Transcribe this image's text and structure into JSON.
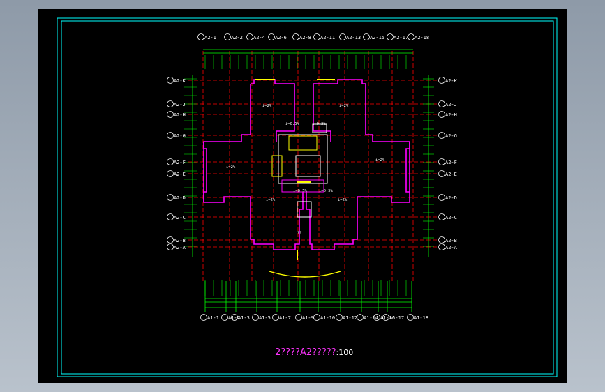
{
  "drawing": {
    "title_main": "2????A2?????",
    "title_scale": ":100",
    "colors": {
      "background": "#000000",
      "frame": "#00ffff",
      "axis": "#ff0000",
      "dimension": "#00ff00",
      "wall": "#ff00ff",
      "text": "#ffffff",
      "accent": "#ffff00"
    },
    "top_axes": [
      "A2-1",
      "A2-2",
      "A2-4",
      "A2-6",
      "A2-8",
      "A2-11",
      "A2-13",
      "A2-15",
      "A2-17",
      "A2-18"
    ],
    "bottom_axes": [
      "A1-1",
      "A1-2",
      "A1-3",
      "A1-5",
      "A1-7",
      "A1-9",
      "A1-10",
      "A1-12",
      "A1-14",
      "A1-16",
      "A1-17",
      "A1-18"
    ],
    "left_axes": [
      "A2-K",
      "A2-J",
      "A2-H",
      "A2-G",
      "A2-F",
      "A2-E",
      "A2-D",
      "A2-C",
      "A2-B",
      "A2-A"
    ],
    "right_axes": [
      "A2-K",
      "A2-J",
      "A2-H",
      "A2-G",
      "A2-F",
      "A2-E",
      "A2-D",
      "A2-C",
      "A2-B",
      "A2-A"
    ],
    "room_labels": [
      {
        "text": "i=2%"
      },
      {
        "text": "i=2%"
      },
      {
        "text": "i=0.5%"
      },
      {
        "text": "i=0.5%"
      },
      {
        "text": "i=2%"
      },
      {
        "text": "i=2%"
      },
      {
        "text": "i=2%"
      },
      {
        "text": "i=2%"
      },
      {
        "text": "i=0.5%"
      },
      {
        "text": "i=0.5%"
      },
      {
        "text": "??"
      }
    ]
  }
}
